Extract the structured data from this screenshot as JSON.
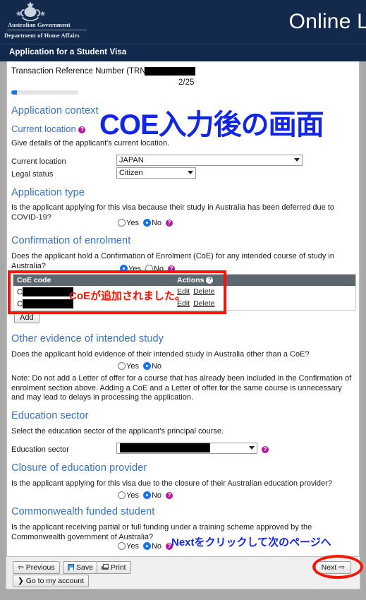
{
  "header": {
    "crest_alt": "australian-coat-of-arms",
    "gov_line1": "Australian Government",
    "gov_line2": "Department of Home Affairs",
    "app_title": "Online L",
    "subbar_title": "Application for a Student Visa",
    "bg_color": "#132A4D"
  },
  "progress": {
    "trn_label": "Transaction Reference Number (TRN",
    "page_count": "2/25",
    "percent": 8
  },
  "sections": {
    "application_context": {
      "heading": "Application context"
    },
    "current_location": {
      "heading": "Current location",
      "description": "Give details of the applicant's current location.",
      "fields": [
        {
          "label": "Current location",
          "value": "JAPAN"
        },
        {
          "label": "Legal status",
          "value": "Citizen"
        }
      ]
    },
    "application_type": {
      "heading": "Application type",
      "question": "Is the applicant applying for this visa because their study in Australia has been deferred due to COVID-19?",
      "yes_label": "Yes",
      "no_label": "No",
      "selected": "No"
    },
    "confirmation_of_enrolment": {
      "heading": "Confirmation of enrolment",
      "question": "Does the applicant hold a Confirmation of Enrolment (CoE) for any intended course of study in Australia?",
      "yes_label": "Yes",
      "no_label": "No",
      "selected": "Yes",
      "table": {
        "columns": [
          "CoE code",
          "Actions"
        ],
        "rows": [
          {
            "code_prefix": "C",
            "code_redacted": true,
            "edit": "Edit",
            "delete": "Delete"
          },
          {
            "code_prefix": "C",
            "code_redacted": true,
            "edit": "Edit",
            "delete": "Delete"
          }
        ]
      },
      "add_button": "Add"
    },
    "other_evidence": {
      "heading": "Other evidence of intended study",
      "question": "Does the applicant hold evidence of their intended study in Australia other than a CoE?",
      "yes_label": "Yes",
      "no_label": "No",
      "selected": "No",
      "note": "Note: Do not add a Letter of offer for a course that has already been included in the Confirmation of enrolment section above. Adding a CoE and a Letter of offer for the same course is unnecessary and may lead to delays in processing the application."
    },
    "education_sector": {
      "heading": "Education sector",
      "description": "Select the education sector of the applicant's principal course.",
      "field_label": "Education sector",
      "value_redacted": true
    },
    "closure_of_education_provider": {
      "heading": "Closure of education provider",
      "question": "Is the applicant applying for this visa due to the closure of their Australian education provider?",
      "yes_label": "Yes",
      "no_label": "No",
      "selected": "No"
    },
    "commonwealth_funded_student": {
      "heading": "Commonwealth funded student",
      "question": "Is the applicant receiving partial or full funding under a training scheme approved by the Commonwealth government of Australia?",
      "yes_label": "Yes",
      "no_label": "No",
      "selected": "No"
    }
  },
  "buttons": {
    "previous": "Previous",
    "save": "Save",
    "print": "Print",
    "go_to_account": "Go to my account",
    "next": "Next"
  },
  "annotations": {
    "top_note": "COE入力後の画面",
    "coe_note": "CoEが追加されました。",
    "next_note": "Nextをクリックして次のページへ",
    "highlight_color": "#f51500",
    "note_color": "#1226e6"
  }
}
